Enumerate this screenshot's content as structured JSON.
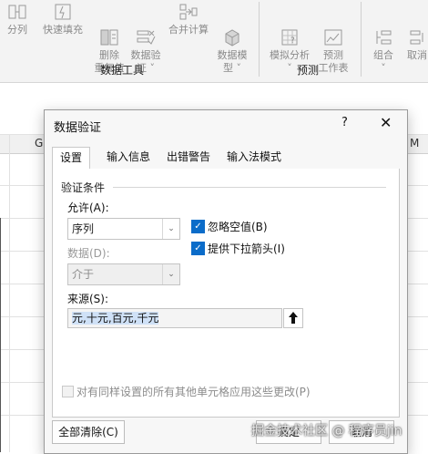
{
  "ribbon": {
    "data_tools_buttons": [
      {
        "label": "分列",
        "icon": "text-to-columns-icon"
      },
      {
        "label": "快速填充",
        "icon": "flash-fill-icon"
      },
      {
        "label": "删除\n重复值",
        "icon": "remove-duplicates-icon"
      },
      {
        "label": "数据验\n证 ˅",
        "icon": "data-validation-icon"
      },
      {
        "label": "合并计算",
        "icon": "consolidate-icon"
      },
      {
        "label": "数据模\n型 ˅",
        "icon": "data-model-icon"
      }
    ],
    "forecast_buttons": [
      {
        "label": "模拟分析\n˅",
        "icon": "what-if-analysis-icon"
      },
      {
        "label": "预测\n工作表",
        "icon": "forecast-sheet-icon"
      }
    ],
    "outline_buttons": [
      {
        "label": "组合\n˅",
        "icon": "group-icon"
      },
      {
        "label": "取消",
        "icon": "ungroup-icon"
      }
    ],
    "group_data_tools": "数据工具",
    "group_forecast": "预测"
  },
  "sheet": {
    "col_g": "G",
    "col_m": "M"
  },
  "dialog": {
    "title": "数据验证",
    "help": "?",
    "close": "✕",
    "tabs": [
      "设置",
      "输入信息",
      "出错警告",
      "输入法模式"
    ],
    "active_tab": 0,
    "section_title": "验证条件",
    "allow_label": "允许(A):",
    "allow_value": "序列",
    "ignore_blank_label": "忽略空值(B)",
    "ignore_blank_checked": true,
    "dropdown_label": "提供下拉箭头(I)",
    "dropdown_checked": true,
    "data_label": "数据(D):",
    "data_value": "介于",
    "source_label": "来源(S):",
    "source_value": "元,十元,百元,千元",
    "apply_all_label": "对有同样设置的所有其他单元格应用这些更改(P)",
    "clear_all_label": "全部清除(C)",
    "ok_label": "确定",
    "cancel_label": "取消"
  },
  "watermark": "掘金技术社区 @ 程序员jin",
  "colors": {
    "accent": "#0b6cc9",
    "ribbon_bg": "#f3f3f3",
    "dialog_bg": "#f7f7f7"
  }
}
